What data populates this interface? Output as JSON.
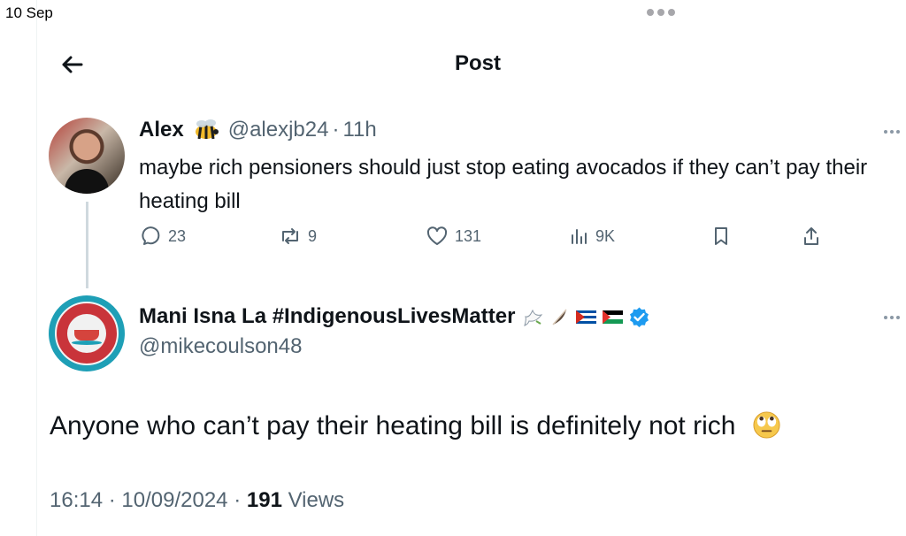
{
  "status_bar": {
    "date": "10 Sep"
  },
  "header": {
    "title": "Post"
  },
  "reply_context": {
    "display_name": "Alex",
    "handle": "@alexjb24",
    "separator": "·",
    "time_ago": "11h",
    "name_emoji": "bee-icon",
    "text": "maybe rich pensioners should just stop eating avocados if they can’t pay their heating bill",
    "stats": {
      "replies": "23",
      "reposts": "9",
      "likes": "131",
      "views": "9K"
    }
  },
  "main_post": {
    "display_name": "Mani Isna La #IndigenousLivesMatter",
    "handle": "@mikecoulson48",
    "badges": [
      "dove-icon",
      "feather-icon",
      "cuba-flag-icon",
      "palestine-flag-icon",
      "verified-badge-icon"
    ],
    "text": "Anyone who can’t pay their heating bill is definitely not rich",
    "text_emoji": "eye-roll-emoji",
    "time": "16:14",
    "date": "10/09/2024",
    "views_count": "191",
    "views_label": "Views"
  },
  "colors": {
    "text": "#0f1419",
    "muted": "#536471",
    "thread_line": "#cfd9de",
    "verified": "#1d9bf0"
  }
}
